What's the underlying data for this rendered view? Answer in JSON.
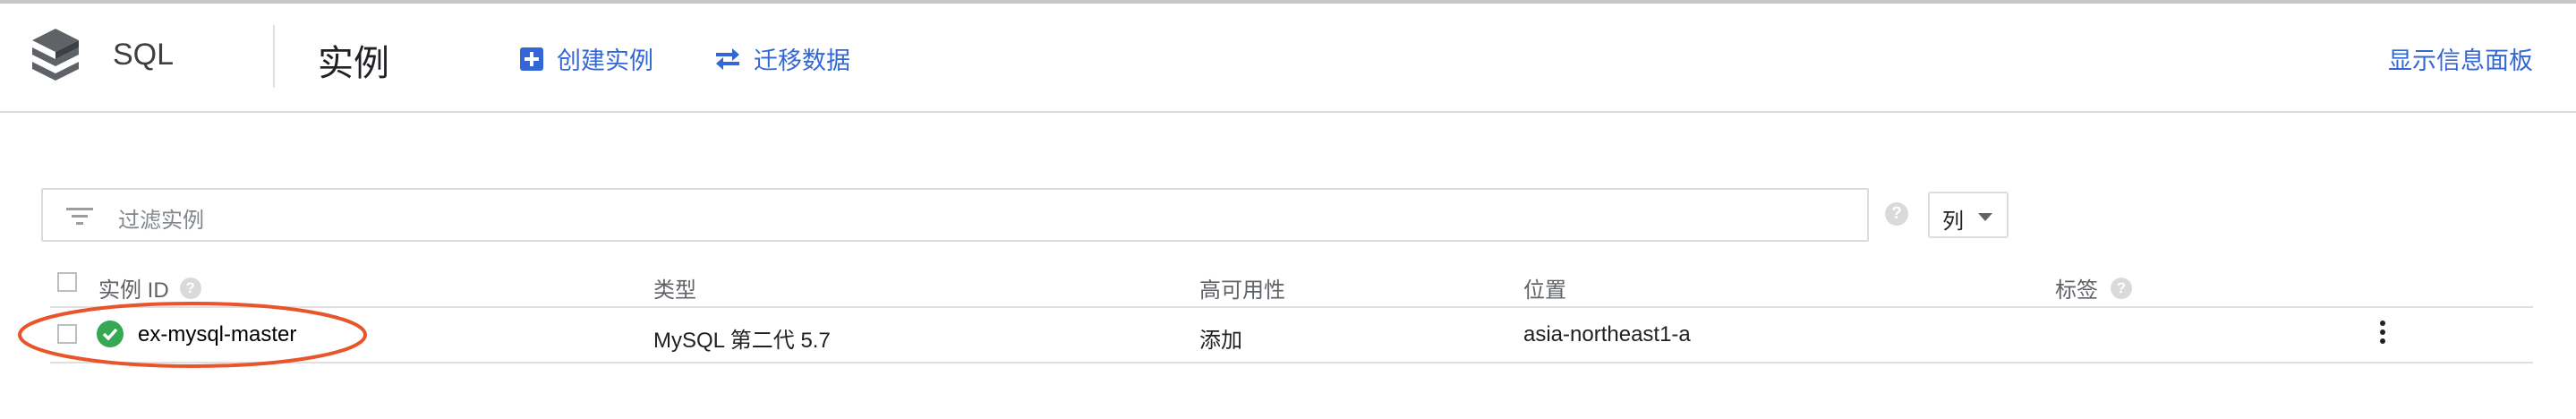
{
  "header": {
    "product_name": "SQL",
    "page_title": "实例",
    "actions": {
      "create_instance": "创建实例",
      "migrate_data": "迁移数据",
      "show_info_panel": "显示信息面板"
    }
  },
  "filter": {
    "placeholder": "过滤实例",
    "columns_button": "列"
  },
  "table": {
    "columns": [
      "实例 ID",
      "类型",
      "高可用性",
      "位置",
      "标签"
    ],
    "rows": [
      {
        "status": "ok",
        "instance_id": "ex-mysql-master",
        "type": "MySQL 第二代 5.7",
        "high_availability": "添加",
        "location": "asia-northeast1-a",
        "labels": ""
      }
    ]
  },
  "colors": {
    "accent": "#3367d6",
    "status_ok": "#34a853",
    "annotation": "#e8552b"
  },
  "icons": [
    "sql-logo-icon",
    "add-box-icon",
    "swap-arrows-icon",
    "filter-list-icon",
    "help-icon",
    "check-circle-icon",
    "more-vert-icon"
  ]
}
